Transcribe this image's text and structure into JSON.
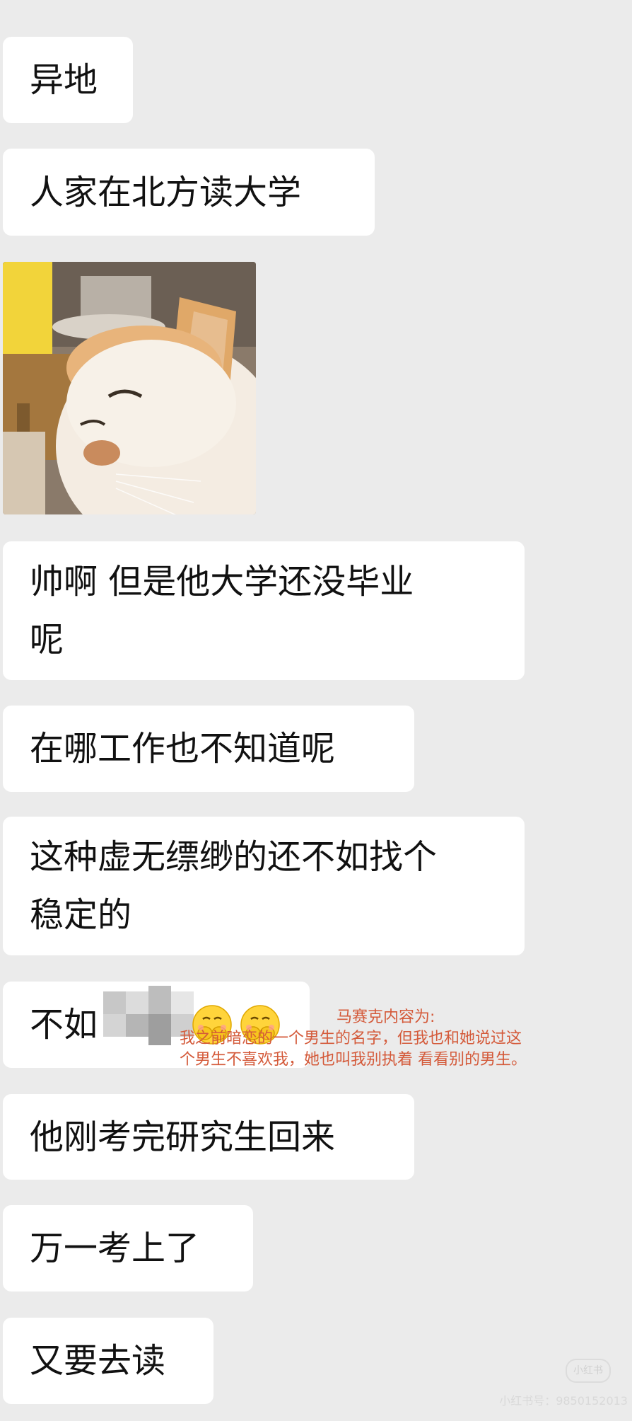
{
  "messages": {
    "m1": "异地",
    "m2": "人家在北方读大学",
    "m3": "帅啊 但是他大学还没毕业\n呢",
    "m4": "在哪工作也不知道呢",
    "m5": "这种虚无缥缈的还不如找个\n稳定的",
    "m6": "不如",
    "m7": "他刚考完研究生回来",
    "m8": "万一考上了",
    "m9": "又要去读"
  },
  "sticker": {
    "icon": "cat-meme-sticker"
  },
  "emojis": [
    "covering-face-emoji",
    "covering-face-emoji"
  ],
  "annotation": {
    "title": "马赛克内容为:",
    "line1": "我之前暗恋的一个男生的名字，但我也和她说过这",
    "line2": "个男生不喜欢我，她也叫我别执着 看看别的男生。"
  },
  "watermark": {
    "badge": "小红书",
    "text": "小红书号：9850152013"
  },
  "colors": {
    "background": "#ebebeb",
    "bubble": "#ffffff",
    "annotation": "#d45a3a"
  }
}
